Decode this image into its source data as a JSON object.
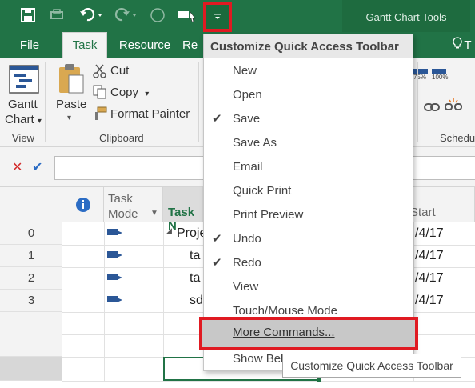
{
  "titlebar": {
    "tools_label": "Gantt Chart Tools",
    "accent": "#217346",
    "icons": [
      "save-icon",
      "quick-print-icon",
      "undo-icon",
      "redo-icon",
      "circle-icon",
      "touch-mode-icon",
      "qat-dropdown-icon"
    ]
  },
  "tabs": [
    {
      "label": "File"
    },
    {
      "label": "Task"
    },
    {
      "label": "Resource"
    },
    {
      "label": "Re"
    },
    {
      "label": "T"
    }
  ],
  "ribbon": {
    "view_group": {
      "button_line1": "Gantt",
      "button_line2": "Chart",
      "label": "View"
    },
    "clipboard_group": {
      "paste": "Paste",
      "cut": "Cut",
      "copy": "Copy",
      "format_painter": "Format Painter",
      "label": "Clipboard"
    },
    "schedule_group": {
      "zoom1": "75%",
      "zoom2": "100%",
      "label": "Schedul"
    }
  },
  "formula_bar": {
    "cancel_symbol": "✕",
    "confirm_symbol": "✔"
  },
  "grid": {
    "headers": {
      "mode_line1": "Task",
      "mode_line2": "Mode",
      "task_name": "Task N",
      "start": "Start"
    },
    "rows": [
      {
        "num": "0",
        "name": "Proje",
        "start": "/4/17",
        "expander": "◢"
      },
      {
        "num": "1",
        "name": "ta",
        "start": "/4/17"
      },
      {
        "num": "2",
        "name": "ta",
        "start": "/4/17"
      },
      {
        "num": "3",
        "name": "sd",
        "start": "/4/17"
      }
    ]
  },
  "menu": {
    "title": "Customize Quick Access Toolbar",
    "items": [
      {
        "label": "New",
        "checked": false
      },
      {
        "label": "Open",
        "checked": false
      },
      {
        "label": "Save",
        "checked": true
      },
      {
        "label": "Save As",
        "checked": false
      },
      {
        "label": "Email",
        "checked": false
      },
      {
        "label": "Quick Print",
        "checked": false
      },
      {
        "label": "Print Preview",
        "checked": false
      },
      {
        "label": "Undo",
        "checked": true
      },
      {
        "label": "Redo",
        "checked": true
      },
      {
        "label": "View",
        "checked": false
      },
      {
        "label": "Touch/Mouse Mode",
        "checked": false
      },
      {
        "label": "More Commands...",
        "checked": false
      },
      {
        "label": "Show Bel",
        "checked": false
      }
    ],
    "check_glyph": "✔"
  },
  "tooltip": {
    "text": "Customize Quick Access Toolbar"
  }
}
